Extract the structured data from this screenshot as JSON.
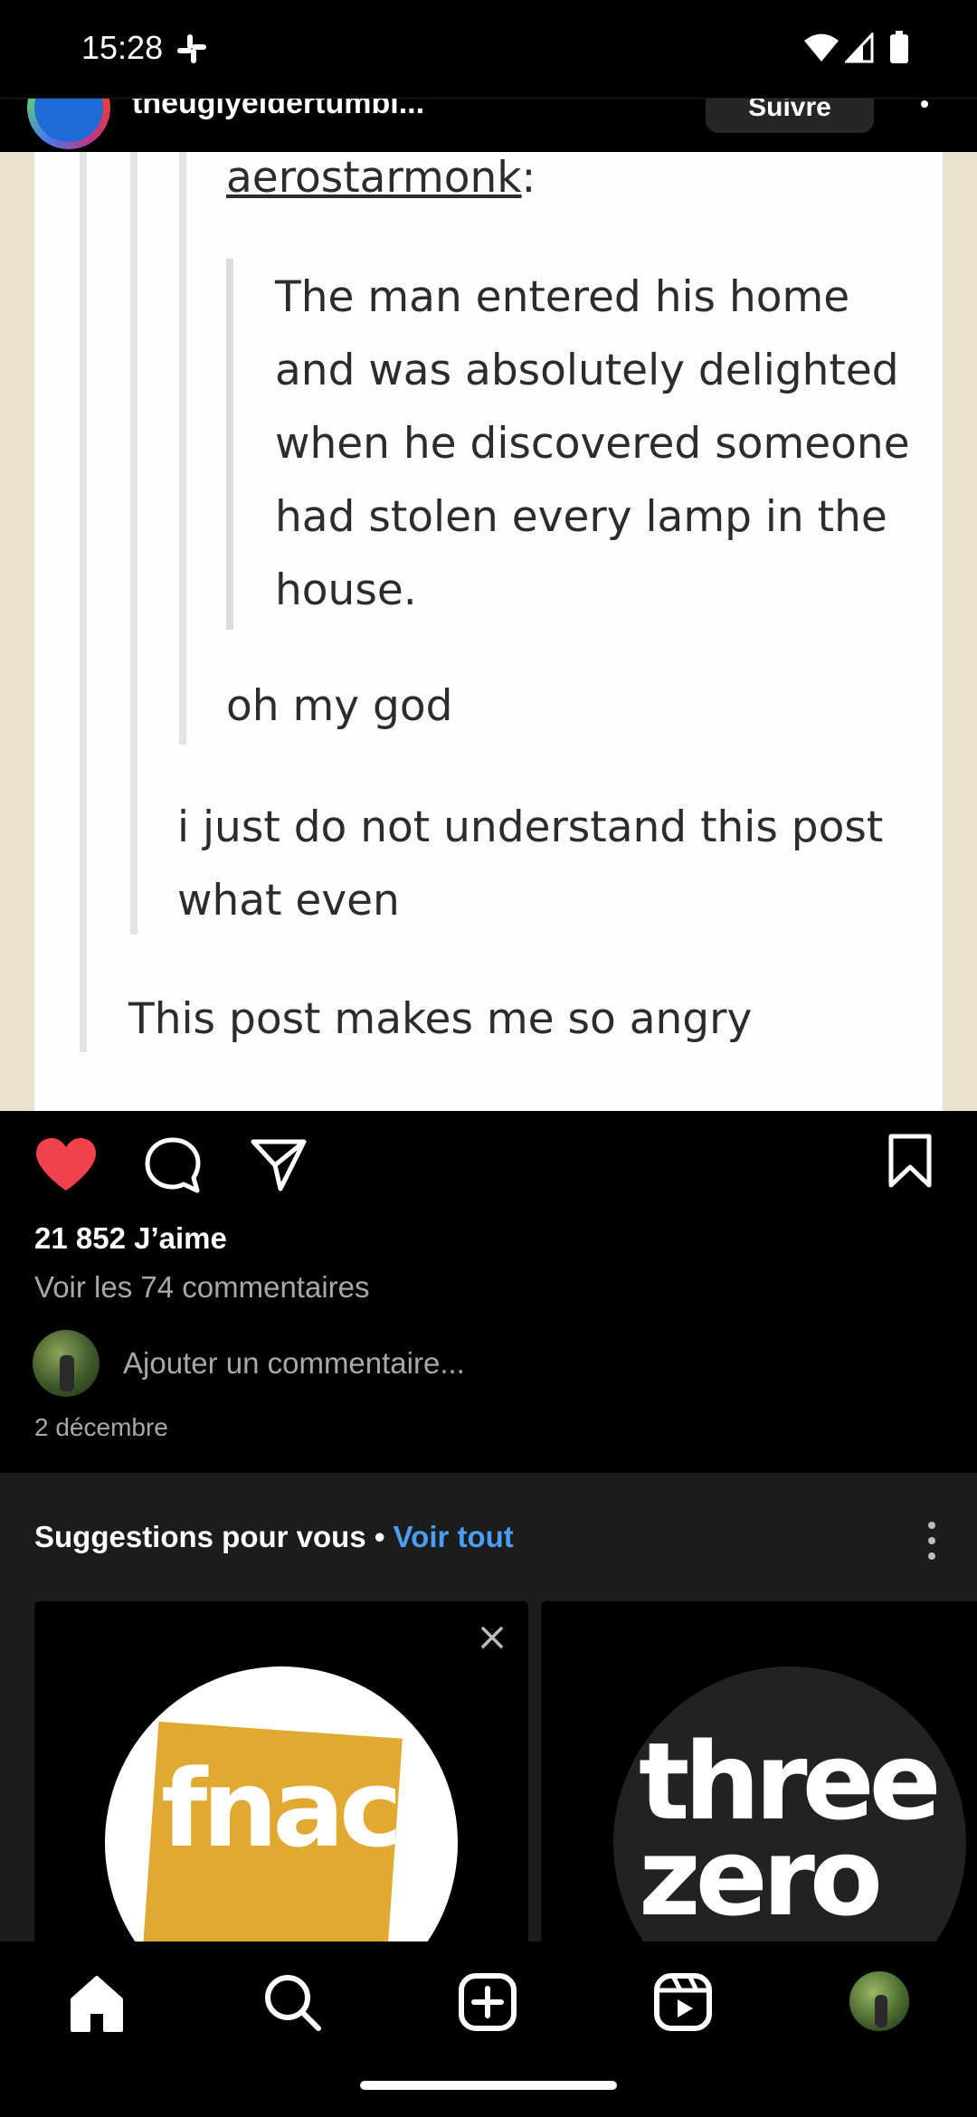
{
  "status_bar": {
    "time": "15:28"
  },
  "post": {
    "header": {
      "username": "theuglyeldertumbl...",
      "follow_label": "Suivre"
    },
    "image_text": {
      "username": "aerostarmonk",
      "colon": ":",
      "quote_lines": [
        "The man entered his home",
        "and was absolutely delighted",
        "when he discovered someone",
        "had stolen every lamp in the",
        "house."
      ],
      "reply1": "oh my god",
      "reply2_lines": [
        "i just do not understand this post",
        "what even"
      ],
      "reply3": "This post makes me so angry"
    },
    "likes": "21 852 J’aime",
    "view_comments": "Voir les 74 commentaires",
    "add_comment_placeholder": "Ajouter un commentaire...",
    "date": "2 décembre"
  },
  "suggestions": {
    "title": "Suggestions pour vous",
    "separator": " • ",
    "see_all": "Voir tout",
    "cards": [
      {
        "logo_text": "fnac"
      },
      {
        "logo_line1": "three",
        "logo_line2": "zero"
      }
    ]
  },
  "nav": {
    "items": [
      "home-icon",
      "search-icon",
      "create-icon",
      "reels-icon",
      "profile-avatar"
    ]
  },
  "colors": {
    "like_red": "#f0414c",
    "link_blue": "#4a9ff5",
    "fnac_yellow": "#e0a932"
  }
}
